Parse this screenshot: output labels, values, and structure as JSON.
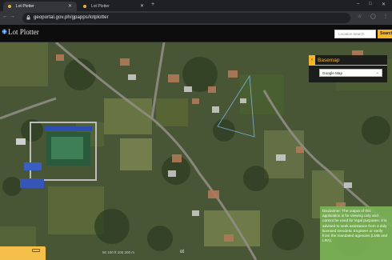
{
  "browser": {
    "tabs": [
      {
        "label": "Lot Plotter",
        "active": true
      },
      {
        "label": "Lot Plotter",
        "active": false
      }
    ],
    "new_tab_icon": "plus-icon",
    "url": "geoportal.gov.ph/gpapps/lotplotter"
  },
  "app": {
    "title": "Lot Plotter",
    "search": {
      "placeholder": "Location search",
      "button_label": "Search"
    }
  },
  "basemap": {
    "label": "Basemap",
    "selected": "Google Map"
  },
  "disclaimer": "Disclaimer: The output of this application is for viewing only and cannot be used for legal purposes. It is advised to seek assistance from a duly licensed Geodetic Engineer or verify from the mandated agencies (LMB and LRA).",
  "bottom": {
    "scale_text": "50  100 ft   100  200 m",
    "lot_label": "ot"
  },
  "colors": {
    "accent": "#f5b52a",
    "disclaimer_bg": "#7ab256",
    "header_bg": "#0d0d0d"
  }
}
